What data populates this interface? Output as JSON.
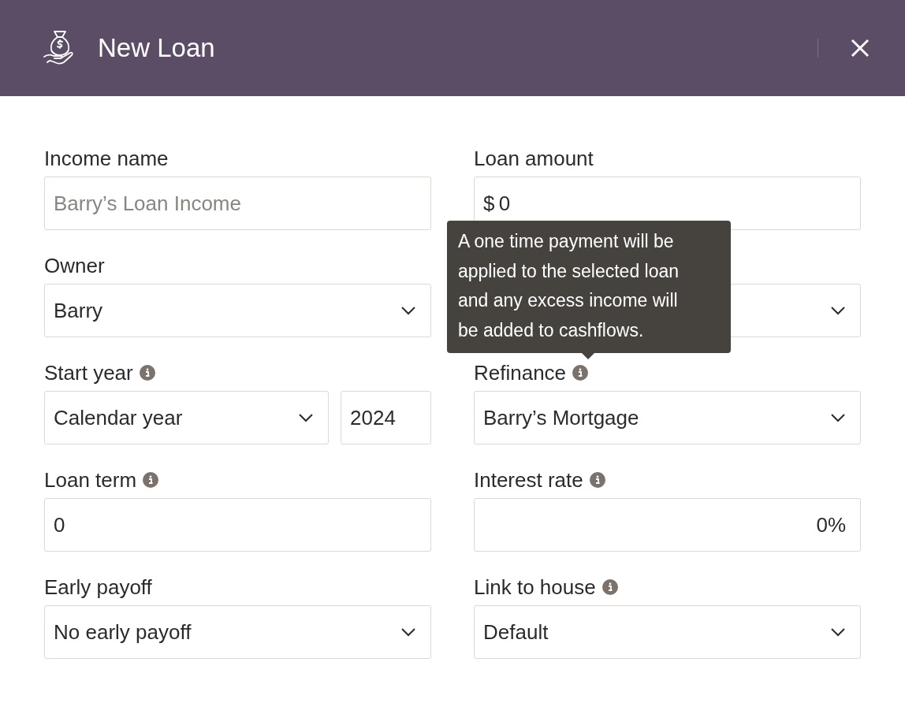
{
  "header": {
    "title": "New Loan"
  },
  "fields": [
    {
      "kind": "text",
      "label": "Income name",
      "placeholder": "Barry’s Loan Income",
      "info": false
    },
    {
      "kind": "money",
      "label": "Loan amount",
      "prefix": "$",
      "value": "0",
      "info": false
    },
    {
      "kind": "select",
      "label": "Owner",
      "value": "Barry",
      "info": false
    },
    {
      "kind": "select"
    },
    {
      "kind": "split",
      "label": "Start year",
      "value": "Calendar year",
      "year": "2024",
      "info": true
    },
    {
      "kind": "select",
      "label": "Refinance",
      "value": "Barry’s Mortgage",
      "info": true,
      "tooltip": "A one time payment will be applied to the selected loan and any excess income will be added to cashflows."
    },
    {
      "kind": "text",
      "label": "Loan term",
      "value": "0",
      "info": true
    },
    {
      "kind": "percent",
      "label": "Interest rate",
      "value": "0%",
      "info": true
    },
    {
      "kind": "select",
      "label": "Early payoff",
      "value": "No early payoff",
      "info": false
    },
    {
      "kind": "select",
      "label": "Link to house",
      "value": "Default",
      "info": true
    }
  ]
}
